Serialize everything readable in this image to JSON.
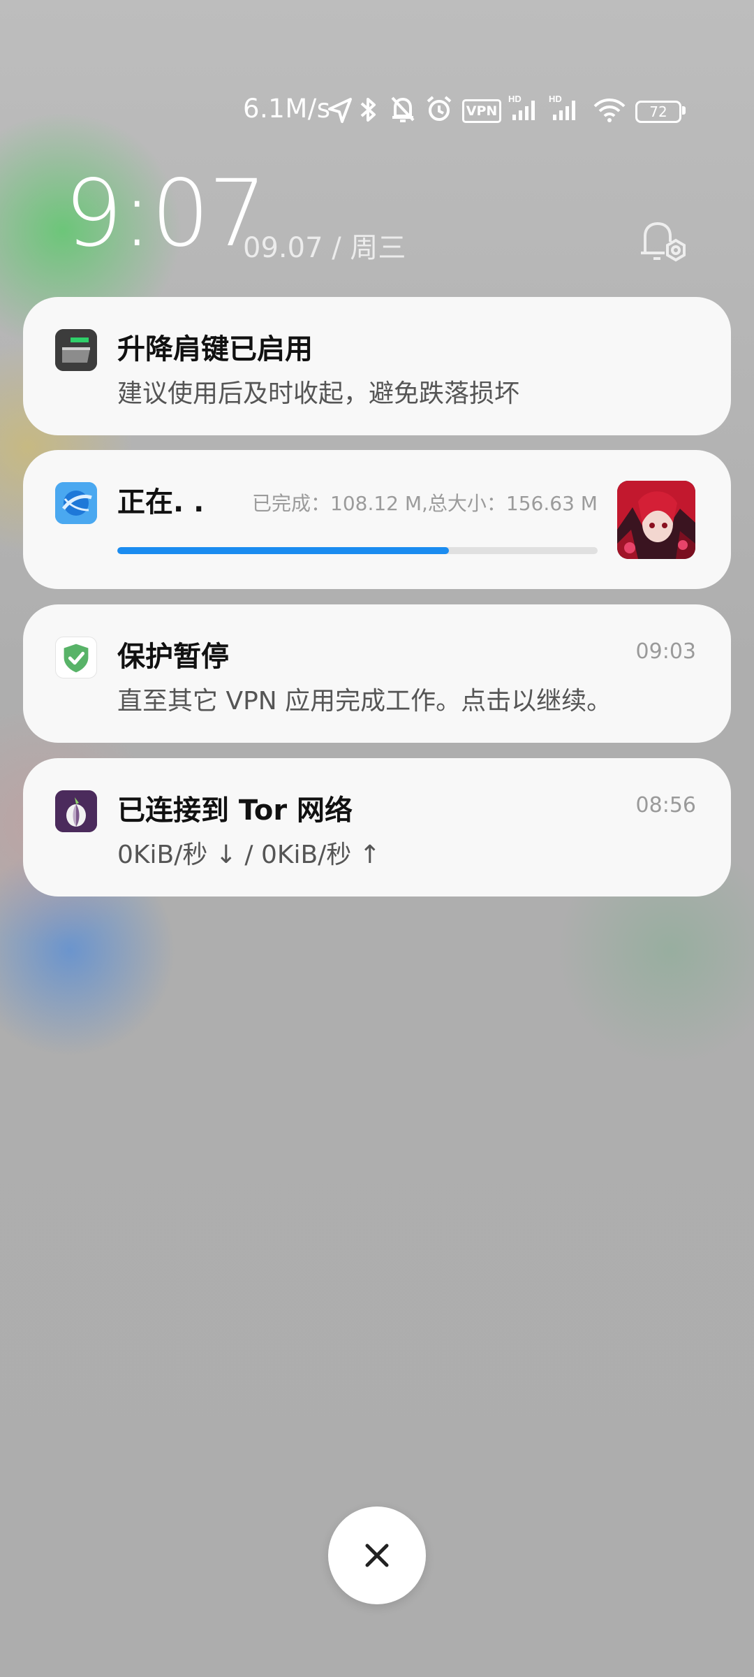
{
  "status_bar": {
    "net_speed": "6.1M/s",
    "vpn_badge": "VPN",
    "battery": "72",
    "icons": [
      "location-icon",
      "bluetooth-icon",
      "bell-muted-icon",
      "alarm-icon",
      "vpn-icon",
      "signal-hd-icon",
      "signal-hd-icon",
      "wifi-icon",
      "battery-icon"
    ]
  },
  "lock": {
    "time": "9:07",
    "date": "09.07 / 周三"
  },
  "notifications": [
    {
      "icon": "button-app-icon",
      "title": "升降肩键已启用",
      "text": "建议使用后及时收起，避免跌落损坏"
    },
    {
      "icon": "browser-download-icon",
      "title": "正在. .",
      "detail": "已完成：108.12 M,总大小：156.63 M",
      "progress": 0.69,
      "thumbnail": "anime-character-thumbnail"
    },
    {
      "icon": "shield-check-icon",
      "title": "保护暂停",
      "time": "09:03",
      "text": "直至其它 VPN 应用完成工作。点击以继续。"
    },
    {
      "icon": "tor-onion-icon",
      "title": "已连接到 Tor 网络",
      "time": "08:56",
      "text": "0KiB/秒 ↓ / 0KiB/秒 ↑"
    }
  ],
  "colors": {
    "accent_progress": "#1b8cf0",
    "shield_green": "#4caf50",
    "tor_purple": "#4a2a5a"
  },
  "dismiss": {
    "symbol": "✕"
  }
}
